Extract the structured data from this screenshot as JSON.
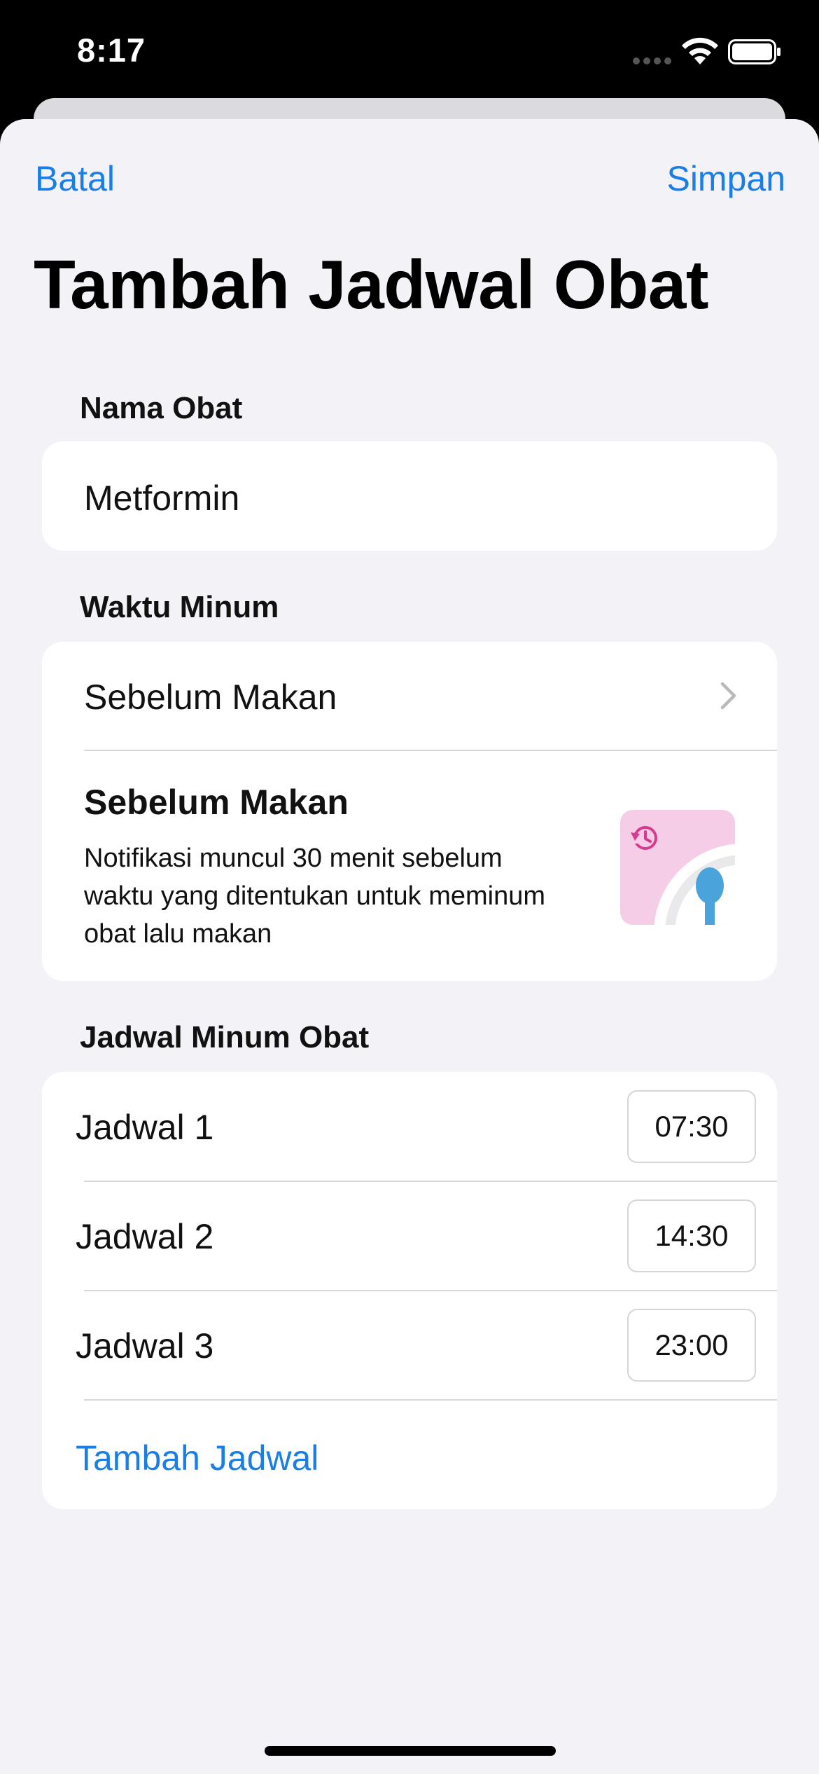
{
  "status_bar": {
    "time": "8:17",
    "icons": [
      "signal-icon",
      "wifi-icon",
      "battery-icon"
    ]
  },
  "nav": {
    "cancel_label": "Batal",
    "save_label": "Simpan"
  },
  "title": "Tambah Jadwal Obat",
  "medicine": {
    "section_label": "Nama Obat",
    "value": "Metformin"
  },
  "timing": {
    "section_label": "Waktu Minum",
    "selected": "Sebelum Makan",
    "info_title": "Sebelum Makan",
    "info_description": "Notifikasi muncul 30 menit sebelum waktu yang ditentukan untuk meminum obat lalu makan",
    "illustration": "before-meal-icon"
  },
  "schedule": {
    "section_label": "Jadwal Minum Obat",
    "items": [
      {
        "label": "Jadwal 1",
        "time": "07:30"
      },
      {
        "label": "Jadwal 2",
        "time": "14:30"
      },
      {
        "label": "Jadwal 3",
        "time": "23:00"
      }
    ],
    "add_label": "Tambah Jadwal"
  },
  "colors": {
    "accent": "#1a7ee8",
    "background": "#f2f2f7",
    "illustration_pink": "#f6cde6",
    "illustration_blue": "#4aa3db"
  }
}
